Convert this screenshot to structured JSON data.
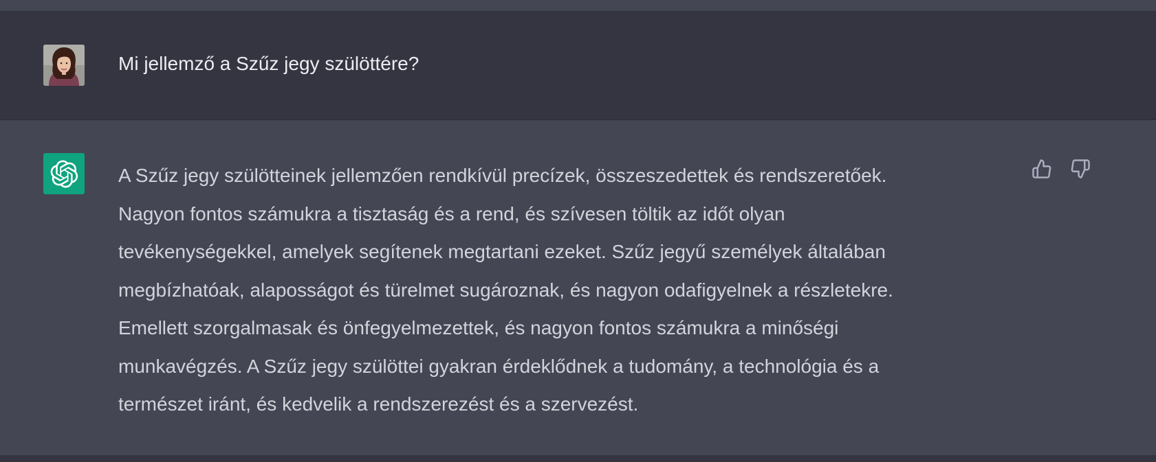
{
  "conversation": {
    "user_message": {
      "avatar": "user-photo-avatar",
      "text": "Mi jellemző a Szűz jegy szülöttére?"
    },
    "assistant_message": {
      "avatar": "openai-logo-icon",
      "lines": [
        "A Szűz jegy szülötteinek jellemzően rendkívül precízek, összeszedettek és rendszeretőek.",
        "Nagyon fontos számukra a tisztaság és a rend, és szívesen töltik az időt olyan",
        "tevékenységekkel, amelyek segítenek megtartani ezeket. Szűz jegyű személyek általában",
        "megbízhatóak, alaposságot és türelmet sugároznak, és nagyon odafigyelnek a részletekre.",
        "Emellett szorgalmasak és önfegyelmezettek, és nagyon fontos számukra a minőségi",
        "munkavégzés. A Szűz jegy szülöttei gyakran érdeklődnek a tudomány, a technológia és a",
        "természet iránt, és kedvelik a rendszerezést és a szervezést."
      ],
      "feedback": {
        "like_icon": "thumbs-up-icon",
        "dislike_icon": "thumbs-down-icon"
      }
    }
  },
  "colors": {
    "user_bg": "#343541",
    "assistant_bg": "#444654",
    "brand_green": "#10a37f",
    "user_text": "#ececf1",
    "assistant_text": "#d1d5db",
    "icon": "#acacbe"
  }
}
